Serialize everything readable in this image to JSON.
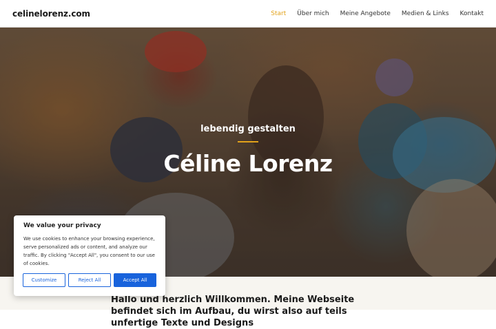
{
  "header": {
    "site_name": "celinelorenz.com",
    "nav": [
      {
        "label": "Start",
        "active": true
      },
      {
        "label": "Über mich",
        "active": false
      },
      {
        "label": "Meine Angebote",
        "active": false
      },
      {
        "label": "Medien & Links",
        "active": false
      },
      {
        "label": "Kontakt",
        "active": false
      }
    ],
    "accent_color": "#e2a21a"
  },
  "hero": {
    "subtitle": "lebendig gestalten",
    "title": "Céline Lorenz"
  },
  "content": {
    "intro": "Hallo und herzlich Willkommen. Meine Webseite befindet sich im Aufbau, du wirst also auf teils unfertige Texte und Designs"
  },
  "cookie_banner": {
    "title": "We value your privacy",
    "text": "We use cookies to enhance your browsing experience, serve personalized ads or content, and analyze our traffic. By clicking \"Accept All\", you consent to our use of cookies.",
    "customize_label": "Customize",
    "reject_label": "Reject All",
    "accept_label": "Accept All",
    "button_color": "#1863dc"
  }
}
